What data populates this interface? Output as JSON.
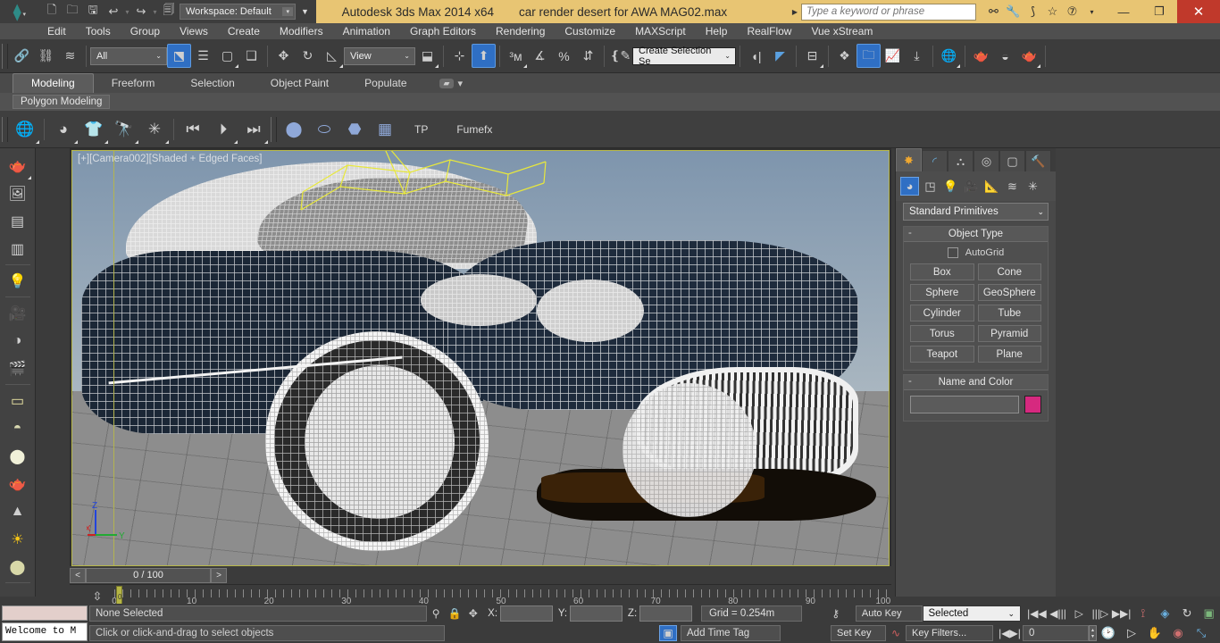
{
  "titlebar": {
    "logo": "max-logo-icon",
    "workspace_label": "Workspace: Default",
    "app_title": "Autodesk 3ds Max  2014 x64",
    "document_title": "car render desert for AWA MAG02.max",
    "search_placeholder": "Type a keyword or phrase",
    "quick_access": [
      {
        "name": "new-file-icon",
        "glyph": "🗋"
      },
      {
        "name": "open-file-icon",
        "glyph": "🗁"
      },
      {
        "name": "save-file-icon",
        "glyph": "🖫"
      },
      {
        "name": "undo-icon",
        "glyph": "↩"
      },
      {
        "name": "redo-icon",
        "glyph": "↪"
      },
      {
        "name": "set-project-folder-icon",
        "glyph": "🗐"
      }
    ],
    "help_icons": [
      {
        "name": "search-binoculars-icon",
        "glyph": "🔍"
      },
      {
        "name": "wrench-icon",
        "glyph": "🔧"
      },
      {
        "name": "satellite-dish-icon",
        "glyph": "📡"
      },
      {
        "name": "favorites-star-icon",
        "glyph": "☆"
      },
      {
        "name": "help-question-icon",
        "glyph": "?"
      }
    ],
    "window_buttons": {
      "minimize": "—",
      "restore": "❐",
      "close": "✕"
    },
    "accent_yellow": "#e8c573",
    "close_red": "#c0392b"
  },
  "menubar": {
    "items": [
      "Edit",
      "Tools",
      "Group",
      "Views",
      "Create",
      "Modifiers",
      "Animation",
      "Graph Editors",
      "Rendering",
      "Customize",
      "MAXScript",
      "Help",
      "RealFlow",
      "Vue xStream"
    ]
  },
  "main_toolbar": {
    "selection_filter": "All",
    "reference_coord_system": "View",
    "named_selection_set": "Create Selection Se",
    "buttons": [
      {
        "name": "select-and-link-icon",
        "glyph": "🔗"
      },
      {
        "name": "unlink-selection-icon",
        "glyph": "⛓"
      },
      {
        "name": "bind-to-space-warp-icon",
        "glyph": "≈"
      },
      {
        "name": "select-object-icon",
        "glyph": "⬒",
        "active": true
      },
      {
        "name": "select-by-name-icon",
        "glyph": "☰"
      },
      {
        "name": "rectangular-selection-region-icon",
        "glyph": "▭"
      },
      {
        "name": "window-crossing-icon",
        "glyph": "◫"
      },
      {
        "name": "select-and-move-icon",
        "glyph": "✥"
      },
      {
        "name": "select-and-rotate-icon",
        "glyph": "↻"
      },
      {
        "name": "select-and-scale-icon",
        "glyph": "◰"
      },
      {
        "name": "use-center-flyout-icon",
        "glyph": "⊹"
      },
      {
        "name": "select-and-manipulate-icon",
        "glyph": "⬆",
        "active": true
      },
      {
        "name": "snaps-toggle-icon",
        "glyph": "3"
      },
      {
        "name": "angle-snap-toggle-icon",
        "glyph": "∠"
      },
      {
        "name": "percent-snap-toggle-icon",
        "glyph": "%"
      },
      {
        "name": "spinner-snap-toggle-icon",
        "glyph": "⇅"
      },
      {
        "name": "edit-named-selection-sets-icon",
        "glyph": "{}"
      },
      {
        "name": "mirror-icon",
        "glyph": "◖◗"
      },
      {
        "name": "align-flyout-icon",
        "glyph": "⊫"
      },
      {
        "name": "layer-explorer-icon",
        "glyph": "▤"
      },
      {
        "name": "toggle-scene-explorer-icon",
        "glyph": "🗂",
        "active": true
      },
      {
        "name": "curve-editor-icon",
        "glyph": "📈"
      },
      {
        "name": "schematic-view-icon",
        "glyph": "⎕"
      },
      {
        "name": "material-editor-icon",
        "glyph": "🌐"
      },
      {
        "name": "render-setup-icon",
        "glyph": "🫖"
      },
      {
        "name": "rendered-frame-window-icon",
        "glyph": "🖼"
      },
      {
        "name": "render-production-icon",
        "glyph": "🫖"
      }
    ]
  },
  "ribbon": {
    "tabs": [
      {
        "label": "Modeling",
        "active": true
      },
      {
        "label": "Freeform",
        "active": false
      },
      {
        "label": "Selection",
        "active": false
      },
      {
        "label": "Object Paint",
        "active": false
      },
      {
        "label": "Populate",
        "active": false
      }
    ],
    "panel_label": "Polygon Modeling"
  },
  "toolbar2": {
    "buttons": [
      {
        "name": "scene-explorer-icon",
        "glyph": "🌐"
      },
      {
        "name": "material-sphere-icon",
        "glyph": "⬤"
      },
      {
        "name": "cloth-icon",
        "glyph": "👕"
      },
      {
        "name": "flight-studio-icon",
        "glyph": "🔭"
      },
      {
        "name": "character-rig-icon",
        "glyph": "⚙"
      },
      {
        "name": "go-to-start-icon",
        "glyph": "◀|"
      },
      {
        "name": "play-animation-icon",
        "glyph": "▶"
      },
      {
        "name": "go-to-end-icon",
        "glyph": "|▶"
      },
      {
        "name": "sphere-primitive-icon",
        "glyph": "⬤"
      },
      {
        "name": "cylinder-primitive-icon",
        "glyph": "⬛"
      },
      {
        "name": "box-primitive-icon",
        "glyph": "⬣"
      },
      {
        "name": "grid-primitive-icon",
        "glyph": "▦"
      }
    ],
    "labels": [
      "TP",
      "Fumefx"
    ]
  },
  "left_toolbar": {
    "buttons": [
      {
        "name": "render-teapot-icon",
        "glyph": "🫖"
      },
      {
        "name": "render-frame-window-icon",
        "glyph": "🖼"
      },
      {
        "name": "render-setup-list-icon",
        "glyph": "▤"
      },
      {
        "name": "render-elements-icon",
        "glyph": "▥"
      },
      {
        "name": "light-lister-icon",
        "glyph": "💡"
      },
      {
        "name": "camera-icon",
        "glyph": "🎥"
      },
      {
        "name": "camera-shader-icon",
        "glyph": "◑"
      },
      {
        "name": "vray-camera-icon",
        "glyph": "🎬"
      },
      {
        "name": "plane-object-icon",
        "glyph": "▭"
      },
      {
        "name": "dome-light-icon",
        "glyph": "◓"
      },
      {
        "name": "sphere-light-icon",
        "glyph": "⬤"
      },
      {
        "name": "teapot-wire-icon",
        "glyph": "🫖"
      },
      {
        "name": "cone-icon",
        "glyph": "▲"
      },
      {
        "name": "sun-light-icon",
        "glyph": "☀"
      },
      {
        "name": "sphere-material-icon",
        "glyph": "⬤"
      }
    ]
  },
  "viewport": {
    "label": "[+][Camera002][Shaded + Edged Faces]",
    "axis": {
      "x": "X",
      "y": "Y",
      "z": "Z",
      "x_color": "#cc2222",
      "y_color": "#22aa33",
      "z_color": "#2244dd"
    },
    "sky_color": "#8ba0b5",
    "ground_color": "#8d8d8d",
    "car_body_color": "#1c2838",
    "wireframe_color": "#ffffff",
    "border_color": "#b8b84a"
  },
  "command_panel": {
    "tabs": [
      {
        "name": "create-tab",
        "glyph": "✶",
        "active": true
      },
      {
        "name": "modify-tab",
        "glyph": "◤"
      },
      {
        "name": "hierarchy-tab",
        "glyph": "⚶"
      },
      {
        "name": "motion-tab",
        "glyph": "◎"
      },
      {
        "name": "display-tab",
        "glyph": "🖵"
      },
      {
        "name": "utilities-tab",
        "glyph": "🔨"
      }
    ],
    "category_icons": [
      {
        "name": "geometry-icon",
        "glyph": "⬤",
        "active": true
      },
      {
        "name": "shapes-icon",
        "glyph": "◳"
      },
      {
        "name": "lights-icon",
        "glyph": "💡"
      },
      {
        "name": "cameras-icon",
        "glyph": "🎥"
      },
      {
        "name": "helpers-icon",
        "glyph": "📏"
      },
      {
        "name": "space-warps-icon",
        "glyph": "≋"
      },
      {
        "name": "systems-icon",
        "glyph": "✳"
      }
    ],
    "category_dropdown": "Standard Primitives",
    "rollouts": [
      {
        "title": "Object Type",
        "autogrid_label": "AutoGrid",
        "autogrid_checked": false,
        "buttons": [
          "Box",
          "Cone",
          "Sphere",
          "GeoSphere",
          "Cylinder",
          "Tube",
          "Torus",
          "Pyramid",
          "Teapot",
          "Plane"
        ]
      },
      {
        "title": "Name and Color",
        "name_value": "",
        "color": "#d6297f"
      }
    ]
  },
  "time_slider": {
    "current_frame_text": "0 / 100",
    "prev_arrow": "<",
    "next_arrow": ">"
  },
  "track_bar": {
    "start": 0,
    "end": 100,
    "major_ticks": [
      0,
      10,
      20,
      30,
      40,
      50,
      60,
      70,
      80,
      90,
      100
    ],
    "cursor_frame": 0,
    "cursor_label": "0"
  },
  "maxscript_listener": {
    "text": "Welcome to M"
  },
  "status_bar": {
    "selection_status": "None Selected",
    "prompt": "Click or click-and-drag to select objects",
    "transform_lock_icons": [
      {
        "name": "isolate-selection-icon",
        "glyph": "⚲"
      },
      {
        "name": "selection-lock-toggle-icon",
        "glyph": "🔒"
      },
      {
        "name": "absolute-relative-mode-icon",
        "glyph": "✥"
      }
    ],
    "coords": {
      "x_label": "X:",
      "x_value": "",
      "y_label": "Y:",
      "y_value": "",
      "z_label": "Z:",
      "z_value": ""
    },
    "grid_text": "Grid = 0.254m",
    "key_icon": "🔑",
    "add_time_tag": "Add Time Tag",
    "auto_key_label": "Auto Key",
    "set_key_label": "Set Key",
    "key_mode_dropdown": "Selected",
    "key_filters_label": "Key Filters...",
    "key_frame_value": "0",
    "playback_buttons": [
      {
        "name": "go-to-start-button",
        "glyph": "|◀◀"
      },
      {
        "name": "previous-frame-button",
        "glyph": "◀|||"
      },
      {
        "name": "play-animation-button",
        "glyph": "▷"
      },
      {
        "name": "next-frame-button",
        "glyph": "|||▷"
      },
      {
        "name": "go-to-end-button",
        "glyph": "▶▶|"
      }
    ],
    "anim_tools": [
      {
        "name": "key-mode-toggle-icon",
        "glyph": "|◀▶|"
      },
      {
        "name": "time-configuration-icon",
        "glyph": "🕑"
      }
    ],
    "transform_tools": [
      {
        "name": "set-key-point-icon",
        "glyph": "⟟"
      },
      {
        "name": "select-and-link-diamond-icon",
        "glyph": "◈"
      },
      {
        "name": "arc-rotate-icon",
        "glyph": "↻"
      },
      {
        "name": "maximize-viewport-toggle-icon",
        "glyph": "▣"
      }
    ],
    "nav_tools": [
      {
        "name": "zoom-icon",
        "glyph": "▷"
      },
      {
        "name": "pan-view-icon",
        "glyph": "✋"
      },
      {
        "name": "orbit-icon",
        "glyph": "◉"
      },
      {
        "name": "maximize-viewport-icon",
        "glyph": "⤢"
      }
    ]
  }
}
